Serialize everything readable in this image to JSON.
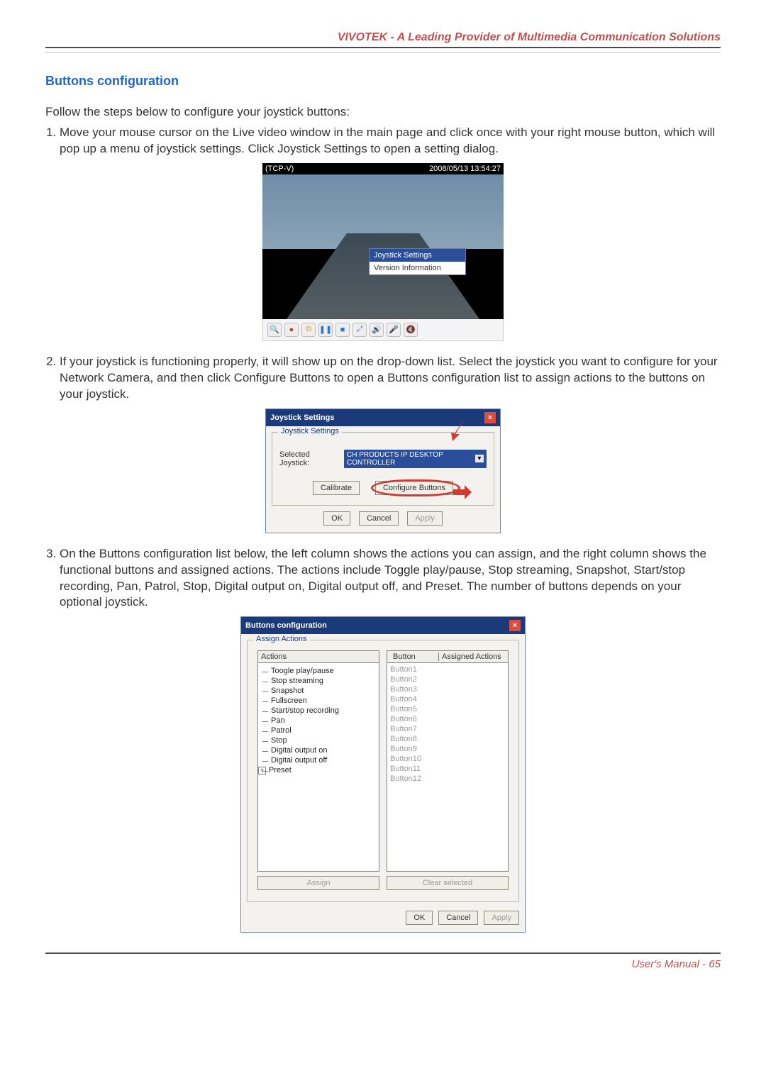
{
  "header": {
    "company_line": "VIVOTEK - A Leading Provider of Multimedia Communication Solutions"
  },
  "section": {
    "title": "Buttons configuration",
    "intro": "Follow the steps below to configure your joystick buttons:",
    "steps": [
      "Move your mouse cursor on the Live video window in the main page and click once with your right mouse button, which will pop up a menu of joystick settings. Click Joystick Settings to open a setting dialog.",
      "If your joystick is functioning properly, it will show up on the drop-down list. Select the joystick you want to configure for your Network Camera, and then click Configure Buttons to open a Buttons configuration list to assign actions to the buttons on your joystick.",
      "On the Buttons configuration list below, the left column shows the actions you can assign, and the right column shows the functional buttons and assigned actions. The actions include Toggle play/pause, Stop streaming, Snapshot, Start/stop recording, Pan, Patrol, Stop, Digital output on, Digital output off, and Preset. The number of buttons depends on your optional joystick."
    ]
  },
  "live_window": {
    "left_label": "(TCP-V)",
    "timestamp": "2008/05/13 13:54:27",
    "context_menu": {
      "items": [
        "Joystick Settings",
        "Version Information"
      ],
      "selected_index": 0
    },
    "toolbar_icons": [
      "magnifier-icon",
      "record-icon",
      "snapshot-icon",
      "pause-icon",
      "stop-icon",
      "expand-icon",
      "volume-icon",
      "mic-on-icon",
      "mic-off-icon"
    ]
  },
  "joystick_dialog": {
    "title": "Joystick Settings",
    "group_label": "Joystick Settings",
    "selected_label": "Selected Joystick:",
    "selected_value": "CH PRODUCTS IP DESKTOP CONTROLLER",
    "calibrate_label": "Calibrate",
    "configure_label": "Configure Buttons",
    "ok_label": "OK",
    "cancel_label": "Cancel",
    "apply_label": "Apply"
  },
  "buttons_dialog": {
    "title": "Buttons configuration",
    "group_label": "Assign Actions",
    "actions_header": "Actions",
    "actions": [
      "Toogle play/pause",
      "Stop streaming",
      "Snapshot",
      "Fullscreen",
      "Start/stop recording",
      "Pan",
      "Patrol",
      "Stop",
      "Digital output on",
      "Digital output off"
    ],
    "preset_label": "Preset",
    "button_header": "Button",
    "assigned_header": "Assigned Actions",
    "buttons_list": [
      "Button1",
      "Button2",
      "Button3",
      "Button4",
      "Button5",
      "Button6",
      "Button7",
      "Button8",
      "Button9",
      "Button10",
      "Button11",
      "Button12"
    ],
    "assign_label": "Assign",
    "clear_label": "Clear selected",
    "ok_label": "OK",
    "cancel_label": "Cancel",
    "apply_label": "Apply"
  },
  "footer": {
    "text": "User's Manual - 65"
  }
}
